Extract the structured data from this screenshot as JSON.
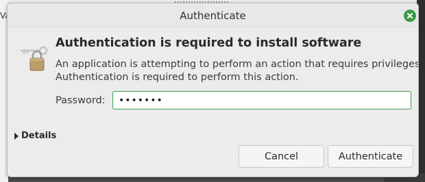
{
  "background": {
    "left_fragment_text": "Va"
  },
  "dialog": {
    "title": "Authenticate",
    "heading": "Authentication is required to install software",
    "description_line1": "An application is attempting to perform an action that requires privileges.",
    "description_line2": "Authentication is required to perform this action.",
    "password_label": "Password:",
    "password_value": "passwrd",
    "details_label": "Details",
    "cancel_label": "Cancel",
    "authenticate_label": "Authenticate"
  },
  "icons": {
    "close": "close-icon",
    "lock": "lock-key-icon",
    "details_toggle": "disclosure-triangle-icon"
  },
  "colors": {
    "accent": "#3c9a4a",
    "dialog_bg": "#ececec"
  }
}
